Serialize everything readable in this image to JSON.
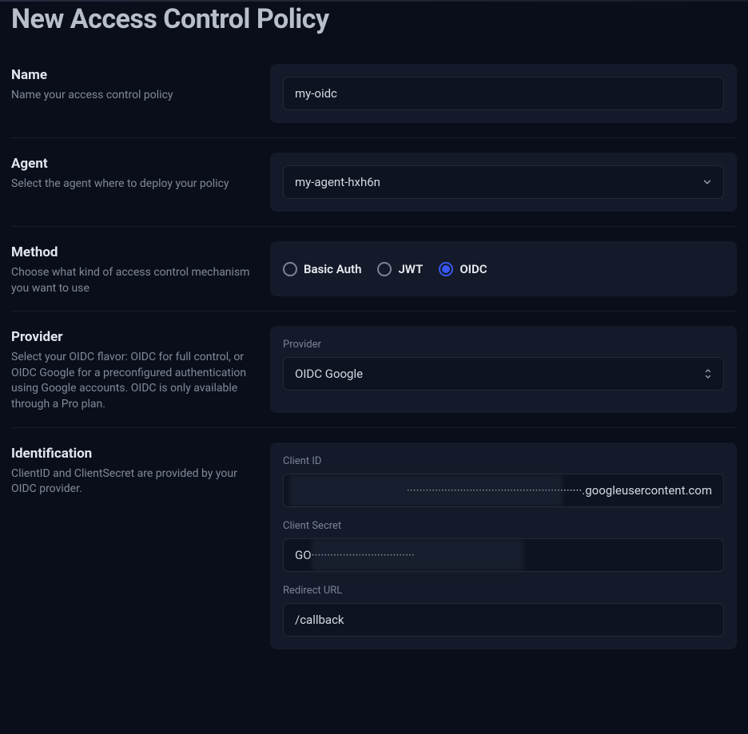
{
  "page": {
    "title": "New Access Control Policy"
  },
  "name_section": {
    "label": "Name",
    "desc": "Name your access control policy",
    "value": "my-oidc"
  },
  "agent_section": {
    "label": "Agent",
    "desc": "Select the agent where to deploy your policy",
    "value": "my-agent-hxh6n"
  },
  "method_section": {
    "label": "Method",
    "desc": "Choose what kind of access control mechanism you want to use",
    "options": {
      "basic_auth": "Basic Auth",
      "jwt": "JWT",
      "oidc": "OIDC"
    },
    "selected": "oidc"
  },
  "provider_section": {
    "label": "Provider",
    "desc": "Select your OIDC flavor: OIDC for full control, or OIDC Google for a preconfigured authentication using Google accounts. OIDC is only available through a Pro plan.",
    "field_label": "Provider",
    "value": "OIDC Google"
  },
  "identification_section": {
    "label": "Identification",
    "desc": "ClientID and ClientSecret are provided by your OIDC provider.",
    "client_id_label": "Client ID",
    "client_id_value": "························································.googleusercontent.com",
    "client_secret_label": "Client Secret",
    "client_secret_value": "GO·································",
    "redirect_url_label": "Redirect URL",
    "redirect_url_value": "/callback"
  },
  "colors": {
    "accent": "#3857f0",
    "bg": "#0a0e1a",
    "panel": "#141a29",
    "input_bg": "#0d1320"
  }
}
